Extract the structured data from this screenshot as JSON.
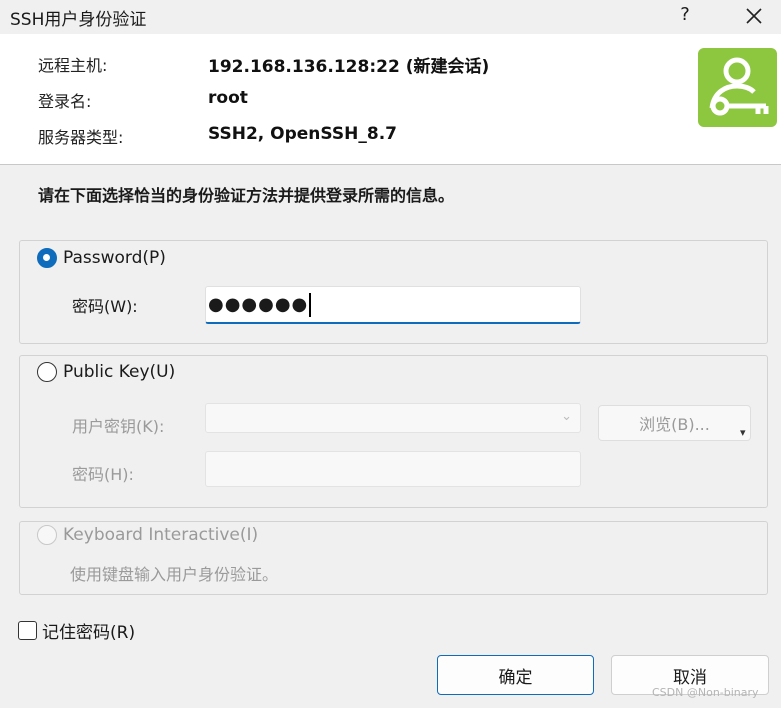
{
  "window": {
    "title": "SSH用户身份验证",
    "help_label": "?",
    "close_icon": "close-icon"
  },
  "connection_info": {
    "remote_host_label": "远程主机:",
    "remote_host_value": "192.168.136.128:22 (新建会话)",
    "login_name_label": "登录名:",
    "login_name_value": "root",
    "server_type_label": "服务器类型:",
    "server_type_value": "SSH2, OpenSSH_8.7",
    "app_icon": "user-key-icon",
    "app_icon_color": "#8dc63f"
  },
  "instruction": "请在下面选择恰当的身份验证方法并提供登录所需的信息。",
  "methods": {
    "password": {
      "label": "Password(P)",
      "selected": true,
      "field_label": "密码(W):",
      "value_mask": "●●●●●●"
    },
    "public_key": {
      "label": "Public Key(U)",
      "selected": false,
      "user_key_label": "用户密钥(K):",
      "user_key_value": "",
      "browse_label": "浏览(B)...",
      "passphrase_label": "密码(H):",
      "passphrase_value": ""
    },
    "keyboard_interactive": {
      "label": "Keyboard Interactive(I)",
      "selected": false,
      "description": "使用键盘输入用户身份验证。"
    }
  },
  "remember_password": {
    "label": "记住密码(R)",
    "checked": false
  },
  "buttons": {
    "ok_label": "确定",
    "cancel_label": "取消"
  },
  "watermark": "CSDN @Non-binary",
  "colors": {
    "accent": "#0f6cbd",
    "background": "#f0f0f0",
    "header_bg": "#ffffff",
    "disabled_text": "#9a9a9a"
  }
}
